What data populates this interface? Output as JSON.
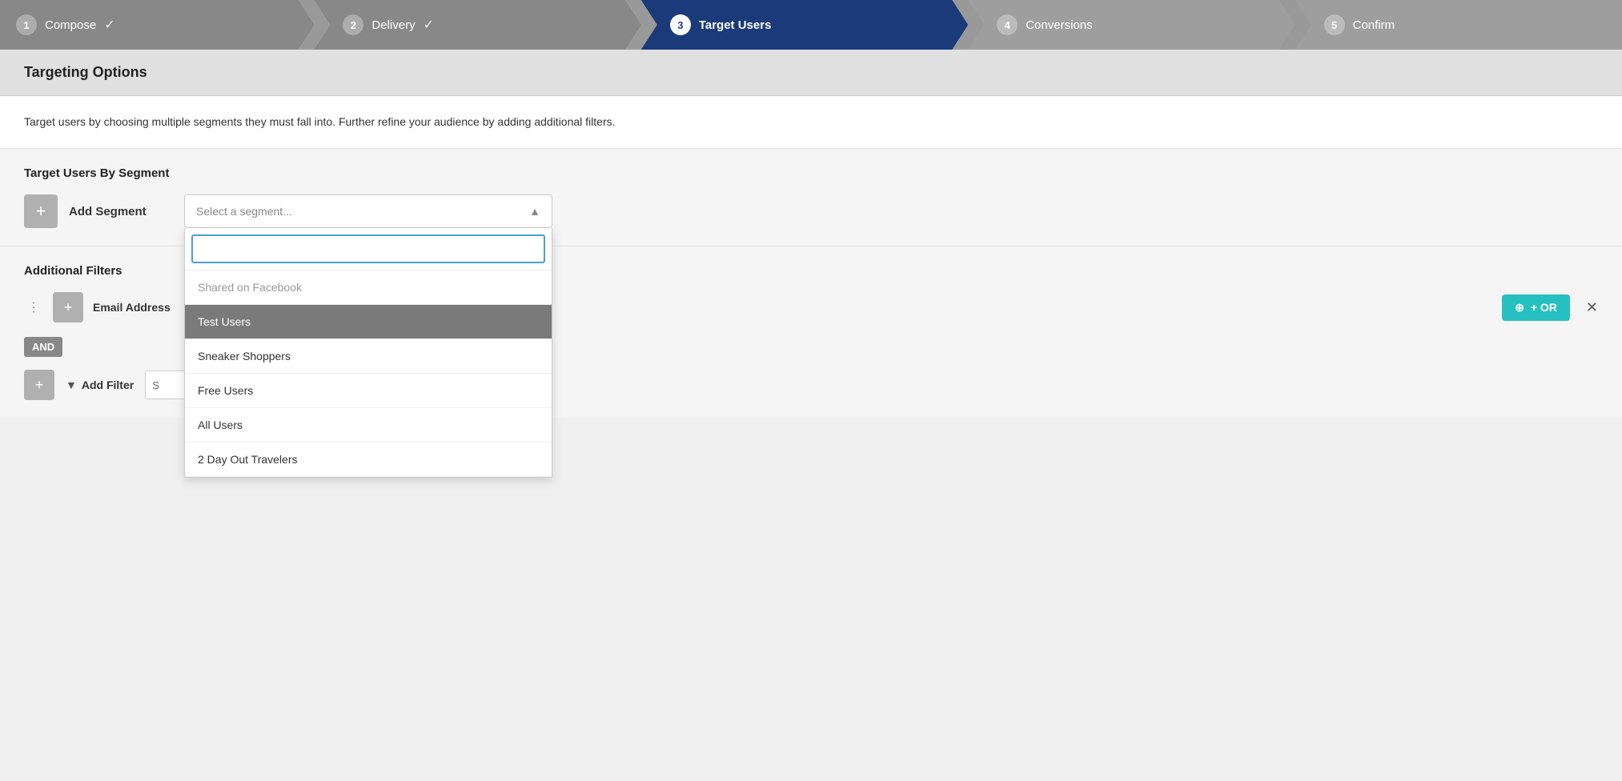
{
  "stepper": {
    "steps": [
      {
        "id": "compose",
        "number": "1",
        "label": "Compose",
        "state": "completed",
        "showCheck": true
      },
      {
        "id": "delivery",
        "number": "2",
        "label": "Delivery",
        "state": "completed",
        "showCheck": true
      },
      {
        "id": "target-users",
        "number": "3",
        "label": "Target Users",
        "state": "active",
        "showCheck": false
      },
      {
        "id": "conversions",
        "number": "4",
        "label": "Conversions",
        "state": "inactive",
        "showCheck": false
      },
      {
        "id": "confirm",
        "number": "5",
        "label": "Confirm",
        "state": "inactive",
        "showCheck": false
      }
    ]
  },
  "page": {
    "section_title": "Targeting Options",
    "description": "Target users by choosing multiple segments they must fall into. Further refine your audience by adding additional filters.",
    "segment_section_title": "Target Users By Segment",
    "add_segment_label": "Add Segment",
    "select_placeholder": "Select a segment...",
    "filters_section_title": "Additional Filters",
    "filter_label": "Email Address",
    "or_button": "+ OR",
    "and_badge": "AND",
    "add_filter_label": "Add Filter",
    "search_placeholder": ""
  },
  "dropdown": {
    "items": [
      {
        "label": "Shared on Facebook",
        "state": "partial"
      },
      {
        "label": "Test Users",
        "state": "highlighted"
      },
      {
        "label": "Sneaker Shoppers",
        "state": "normal"
      },
      {
        "label": "Free Users",
        "state": "normal"
      },
      {
        "label": "All Users",
        "state": "normal"
      },
      {
        "label": "2 Day Out Travelers",
        "state": "normal"
      }
    ]
  }
}
